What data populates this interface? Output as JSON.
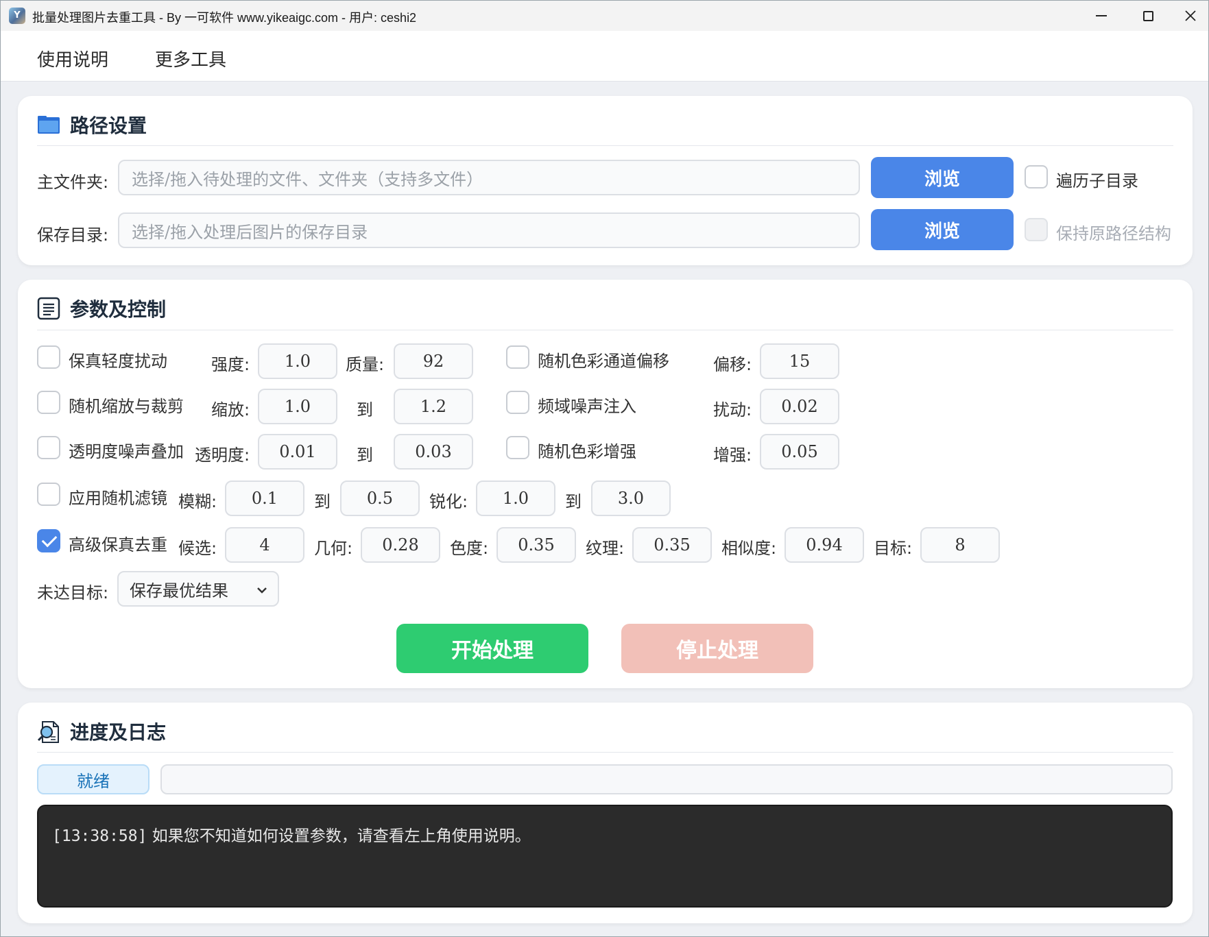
{
  "window": {
    "title": "批量处理图片去重工具 - By 一可软件 www.yikeaigc.com - 用户: ceshi2",
    "icon_label": "Y"
  },
  "menu": {
    "help": "使用说明",
    "more_tools": "更多工具"
  },
  "path_settings": {
    "title": "路径设置",
    "main_folder_label": "主文件夹:",
    "main_folder_placeholder": "选择/拖入待处理的文件、文件夹（支持多文件）",
    "save_dir_label": "保存目录:",
    "save_dir_placeholder": "选择/拖入处理后图片的保存目录",
    "browse": "浏览",
    "traverse_subdirs": "遍历子目录",
    "keep_structure": "保持原路径结构"
  },
  "params": {
    "title": "参数及控制",
    "row1": {
      "option": "保真轻度扰动",
      "strength_label": "强度:",
      "strength": "1.0",
      "quality_label": "质量:",
      "quality": "92",
      "option2": "随机色彩通道偏移",
      "offset_label": "偏移:",
      "offset": "15"
    },
    "row2": {
      "option": "随机缩放与裁剪",
      "scale_label": "缩放:",
      "scale_from": "1.0",
      "to_label": "到",
      "scale_to": "1.2",
      "option2": "频域噪声注入",
      "perturb_label": "扰动:",
      "perturb": "0.02"
    },
    "row3": {
      "option": "透明度噪声叠加",
      "alpha_label": "透明度:",
      "alpha_from": "0.01",
      "to_label": "到",
      "alpha_to": "0.03",
      "option2": "随机色彩增强",
      "enhance_label": "增强:",
      "enhance": "0.05"
    },
    "row4": {
      "option": "应用随机滤镜",
      "blur_label": "模糊:",
      "blur_from": "0.1",
      "to_label": "到",
      "blur_to": "0.5",
      "sharpen_label": "锐化:",
      "sharpen_from": "1.0",
      "to_label2": "到",
      "sharpen_to": "3.0"
    },
    "row5": {
      "option": "高级保真去重",
      "candidates_label": "候选:",
      "candidates": "4",
      "geometry_label": "几何:",
      "geometry": "0.28",
      "chroma_label": "色度:",
      "chroma": "0.35",
      "texture_label": "纹理:",
      "texture": "0.35",
      "similarity_label": "相似度:",
      "similarity": "0.94",
      "target_label": "目标:",
      "target": "8"
    },
    "miss_target_label": "未达目标:",
    "miss_target_value": "保存最优结果",
    "start": "开始处理",
    "stop": "停止处理"
  },
  "progress": {
    "title": "进度及日志",
    "status": "就绪",
    "log_ts": "[13:38:58]",
    "log_msg": " 如果您不知道如何设置参数，请查看左上角使用说明。"
  },
  "colors": {
    "primary": "#4a86e8",
    "start": "#2ecc71",
    "stop_disabled": "#f2c0b8",
    "log_bg": "#2b2b2b"
  }
}
